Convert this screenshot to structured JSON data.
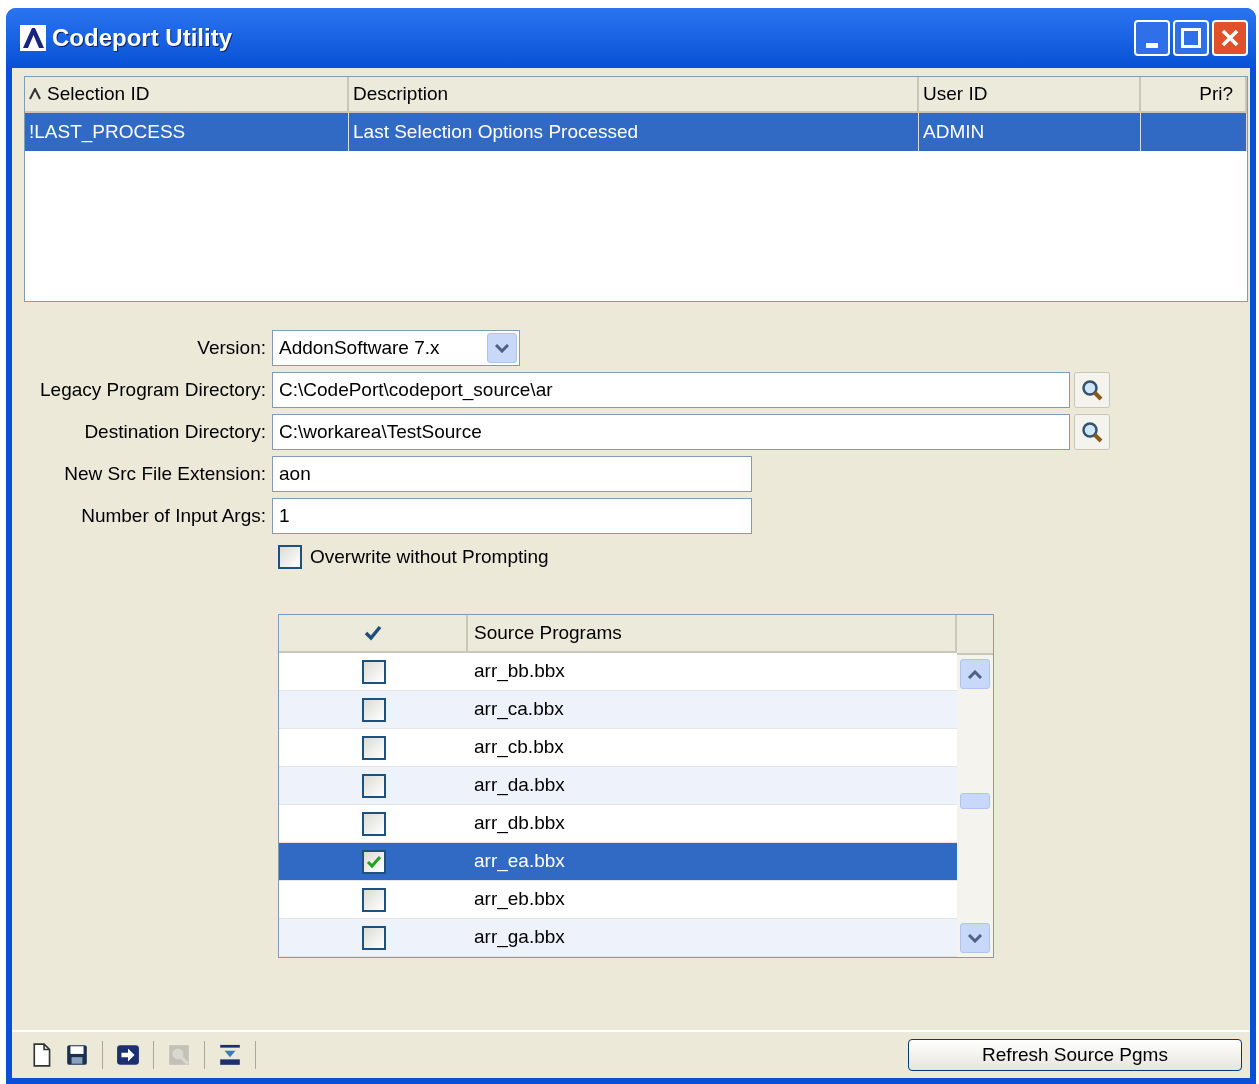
{
  "window": {
    "title": "Codeport Utility"
  },
  "selection_table": {
    "columns": [
      {
        "label": "Selection ID",
        "sorted": true
      },
      {
        "label": "Description",
        "sorted": false
      },
      {
        "label": "User ID",
        "sorted": false
      },
      {
        "label": "Pri?",
        "sorted": false
      }
    ],
    "rows": [
      {
        "cells": [
          "!LAST_PROCESS",
          "Last Selection Options Processed",
          "ADMIN",
          ""
        ],
        "selected": true
      }
    ]
  },
  "form": {
    "fields": [
      {
        "kind": "dropdown",
        "label": "Version:",
        "value": "AddonSoftware 7.x"
      },
      {
        "kind": "browse",
        "label": "Legacy Program Directory:",
        "value": "C:\\CodePort\\codeport_source\\ar"
      },
      {
        "kind": "browse",
        "label": "Destination Directory:",
        "value": "C:\\workarea\\TestSource"
      },
      {
        "kind": "text",
        "label": "New Src File Extension:",
        "value": "aon"
      },
      {
        "kind": "text",
        "label": "Number of Input Args:",
        "value": "1"
      }
    ],
    "overwrite": {
      "label": "Overwrite without Prompting",
      "checked": false
    }
  },
  "source_programs": {
    "column": "Source Programs",
    "rows": [
      {
        "name": "arr_bb.bbx",
        "checked": false,
        "selected": false
      },
      {
        "name": "arr_ca.bbx",
        "checked": false,
        "selected": false
      },
      {
        "name": "arr_cb.bbx",
        "checked": false,
        "selected": false
      },
      {
        "name": "arr_da.bbx",
        "checked": false,
        "selected": false
      },
      {
        "name": "arr_db.bbx",
        "checked": false,
        "selected": false
      },
      {
        "name": "arr_ea.bbx",
        "checked": true,
        "selected": true
      },
      {
        "name": "arr_eb.bbx",
        "checked": false,
        "selected": false
      },
      {
        "name": "arr_ga.bbx",
        "checked": false,
        "selected": false
      }
    ]
  },
  "toolbar": [
    {
      "kind": "new",
      "disabled": false
    },
    {
      "kind": "save",
      "disabled": false
    },
    {
      "kind": "run",
      "disabled": false
    },
    {
      "kind": "zoom",
      "disabled": true
    },
    {
      "kind": "export",
      "disabled": false
    }
  ],
  "buttons": [
    "Refresh Source Pgms"
  ]
}
